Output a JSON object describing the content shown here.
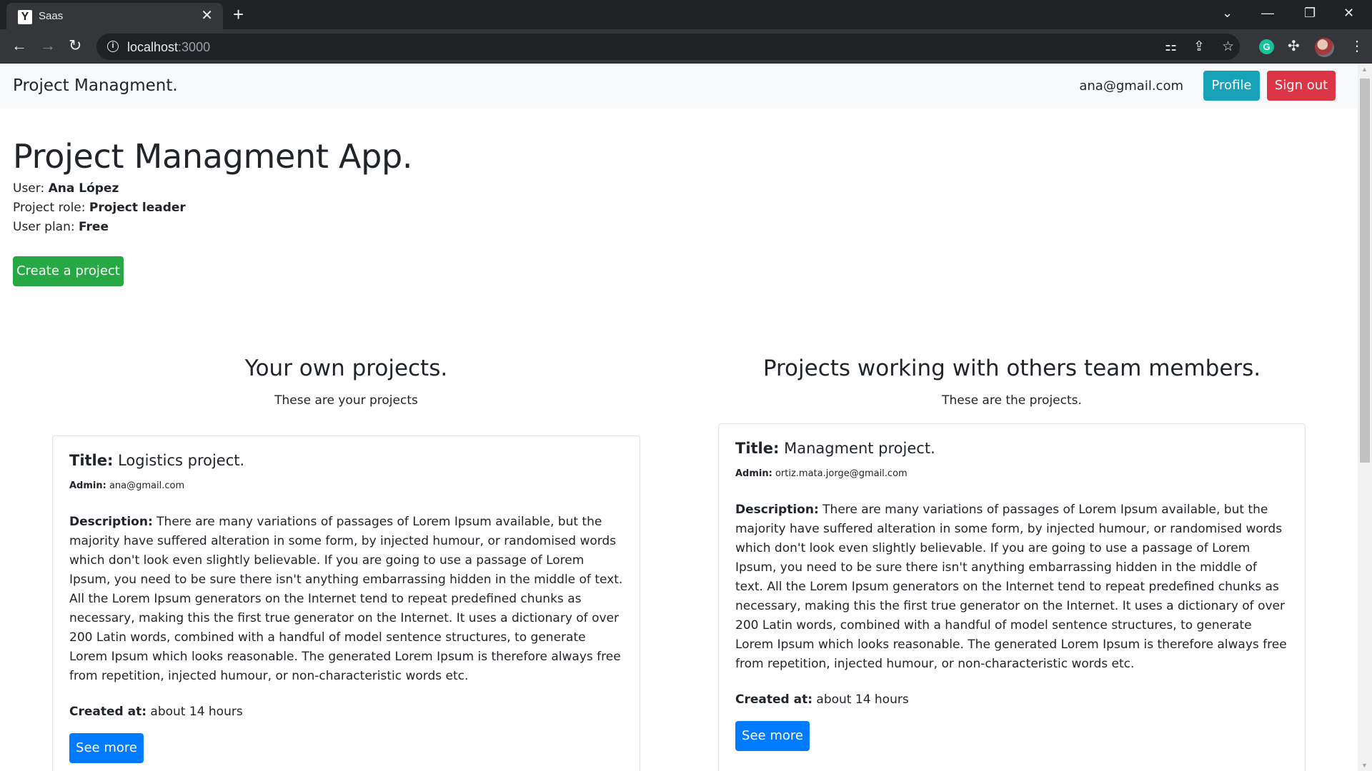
{
  "browser": {
    "tab_favicon": "Y",
    "tab_title": "Saas",
    "url_host": "localhost",
    "url_port": ":3000"
  },
  "navbar": {
    "brand": "Project Managment.",
    "user_email": "ana@gmail.com",
    "profile_label": "Profile",
    "signout_label": "Sign out"
  },
  "header": {
    "title": "Project Managment App.",
    "user_label": "User:",
    "user_value": "Ana López",
    "role_label": "Project role:",
    "role_value": "Project leader",
    "plan_label": "User plan:",
    "plan_value": "Free",
    "create_label": "Create a project"
  },
  "own_section": {
    "title": "Your own projects.",
    "subtitle": "These are your projects",
    "card": {
      "title_label": "Title:",
      "title_value": "Logistics project.",
      "admin_label": "Admin:",
      "admin_value": "ana@gmail.com",
      "desc_label": "Description:",
      "desc_value": "There are many variations of passages of Lorem Ipsum available, but the majority have suffered alteration in some form, by injected humour, or randomised words which don't look even slightly believable. If you are going to use a passage of Lorem Ipsum, you need to be sure there isn't anything embarrassing hidden in the middle of text. All the Lorem Ipsum generators on the Internet tend to repeat predefined chunks as necessary, making this the first true generator on the Internet. It uses a dictionary of over 200 Latin words, combined with a handful of model sentence structures, to generate Lorem Ipsum which looks reasonable. The generated Lorem Ipsum is therefore always free from repetition, injected humour, or non-characteristic words etc.",
      "created_label": "Created at:",
      "created_value": "about 14 hours",
      "button_label": "See more"
    }
  },
  "team_section": {
    "title": "Projects working with others team members.",
    "subtitle": "These are the projects.",
    "card": {
      "title_label": "Title:",
      "title_value": "Managment project.",
      "admin_label": "Admin:",
      "admin_value": "ortiz.mata.jorge@gmail.com",
      "desc_label": "Description:",
      "desc_value": "There are many variations of passages of Lorem Ipsum available, but the majority have suffered alteration in some form, by injected humour, or randomised words which don't look even slightly believable. If you are going to use a passage of Lorem Ipsum, you need to be sure there isn't anything embarrassing hidden in the middle of text. All the Lorem Ipsum generators on the Internet tend to repeat predefined chunks as necessary, making this the first true generator on the Internet. It uses a dictionary of over 200 Latin words, combined with a handful of model sentence structures, to generate Lorem Ipsum which looks reasonable. The generated Lorem Ipsum is therefore always free from repetition, injected humour, or non-characteristic words etc.",
      "created_label": "Created at:",
      "created_value": "about 14 hours",
      "button_label": "See more"
    }
  },
  "colors": {
    "profile": "#17a2b8",
    "signout": "#dc3545",
    "create": "#28a745",
    "see_more": "#007bff",
    "navbar_bg": "#f8f9fa"
  },
  "icons": [
    "close-icon",
    "plus-icon",
    "chevron-down-icon",
    "minimize-icon",
    "restore-icon",
    "window-close-icon",
    "back-icon",
    "forward-icon",
    "reload-icon",
    "info-icon",
    "translate-icon",
    "share-icon",
    "star-icon",
    "grammarly-icon",
    "extensions-icon",
    "avatar-icon",
    "menu-icon"
  ]
}
